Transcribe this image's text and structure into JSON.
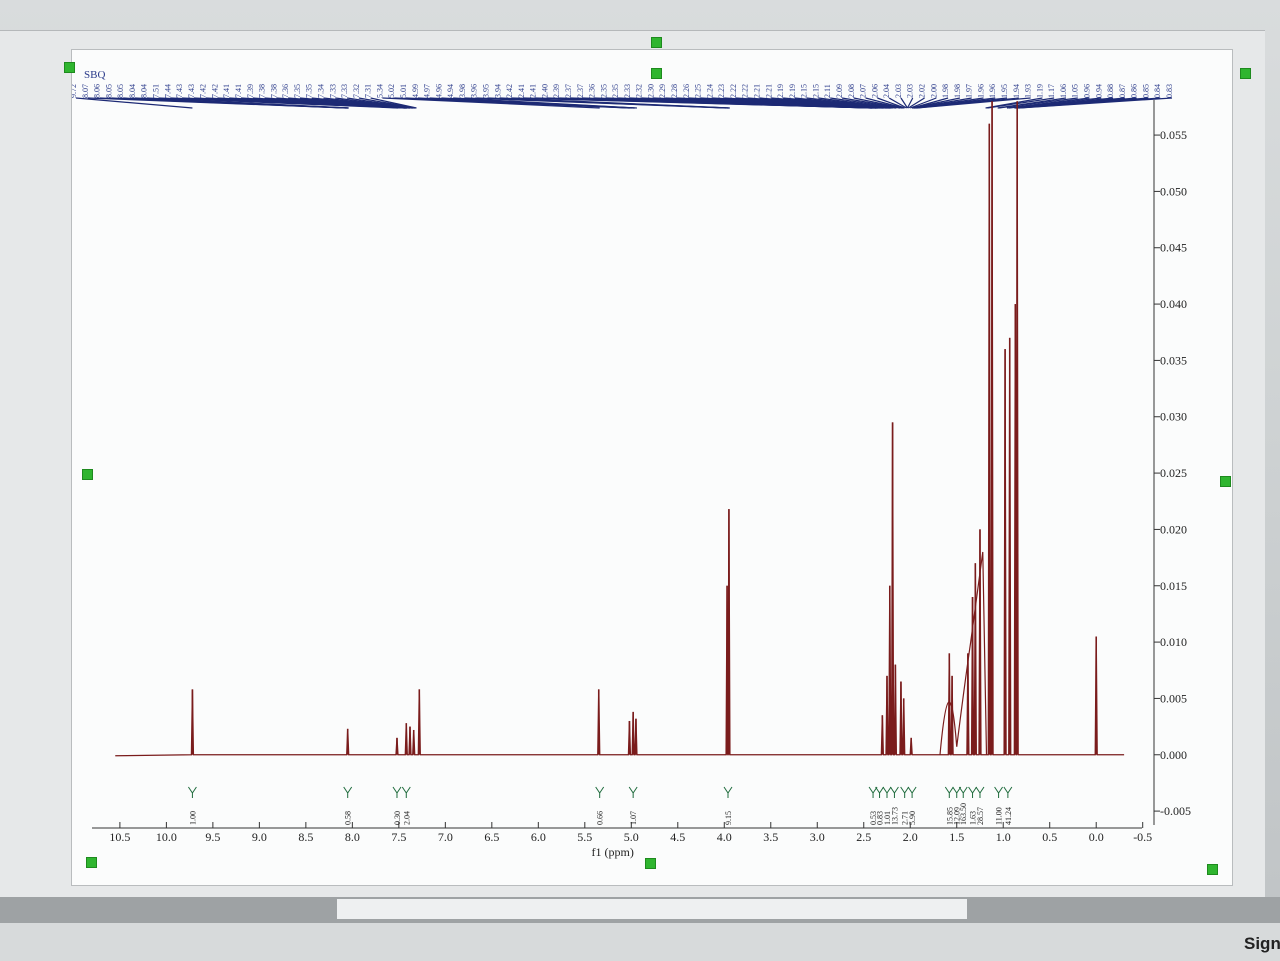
{
  "header": {
    "sample_label": "SBQ"
  },
  "chart_data": {
    "type": "line",
    "title": "",
    "xlabel": "f1 (ppm)",
    "ylabel": "",
    "xlim": [
      10.8,
      -0.6
    ],
    "ylim": [
      -0.0065,
      0.059
    ],
    "x_ticks": [
      "10.5",
      "10.0",
      "9.5",
      "9.0",
      "8.5",
      "8.0",
      "7.5",
      "7.0",
      "6.5",
      "6.0",
      "5.5",
      "5.0",
      "4.5",
      "4.0",
      "3.5",
      "3.0",
      "2.5",
      "2.0",
      "1.5",
      "1.0",
      "0.5",
      "0.0",
      "-0.5"
    ],
    "y_ticks": [
      "0.055",
      "0.050",
      "0.045",
      "0.040",
      "0.035",
      "0.030",
      "0.025",
      "0.020",
      "0.015",
      "0.010",
      "0.005",
      "0.000",
      "-0.005"
    ],
    "grid": false,
    "series": [
      {
        "peaks": [
          {
            "x": 9.72,
            "y": 0.0058
          },
          {
            "x": 8.05,
            "y": 0.0023
          },
          {
            "x": 7.52,
            "y": 0.0015
          },
          {
            "x": 7.42,
            "y": 0.0028
          },
          {
            "x": 7.38,
            "y": 0.0025
          },
          {
            "x": 7.34,
            "y": 0.0022
          },
          {
            "x": 7.28,
            "y": 0.0058
          },
          {
            "x": 5.35,
            "y": 0.0058
          },
          {
            "x": 5.02,
            "y": 0.003
          },
          {
            "x": 4.98,
            "y": 0.0038
          },
          {
            "x": 4.95,
            "y": 0.0032
          },
          {
            "x": 3.95,
            "y": 0.0218
          },
          {
            "x": 3.97,
            "y": 0.015
          },
          {
            "x": 2.3,
            "y": 0.0035
          },
          {
            "x": 2.25,
            "y": 0.007
          },
          {
            "x": 2.22,
            "y": 0.015
          },
          {
            "x": 2.19,
            "y": 0.0295
          },
          {
            "x": 2.16,
            "y": 0.008
          },
          {
            "x": 2.1,
            "y": 0.0065
          },
          {
            "x": 2.07,
            "y": 0.005
          },
          {
            "x": 1.99,
            "y": 0.0015
          },
          {
            "x": 1.58,
            "y": 0.009
          },
          {
            "x": 1.55,
            "y": 0.007
          },
          {
            "x": 1.38,
            "y": 0.009
          },
          {
            "x": 1.33,
            "y": 0.014
          },
          {
            "x": 1.3,
            "y": 0.017
          },
          {
            "x": 1.25,
            "y": 0.02
          },
          {
            "x": 1.15,
            "y": 0.056
          },
          {
            "x": 1.12,
            "y": 0.058
          },
          {
            "x": 0.98,
            "y": 0.036
          },
          {
            "x": 0.93,
            "y": 0.037
          },
          {
            "x": 0.87,
            "y": 0.04
          },
          {
            "x": 0.85,
            "y": 0.058
          },
          {
            "x": 0.0,
            "y": 0.0105
          }
        ]
      }
    ],
    "peak_labels": [
      "9.72",
      "8.07",
      "8.06",
      "8.05",
      "8.05",
      "8.04",
      "8.04",
      "7.51",
      "7.44",
      "7.43",
      "7.43",
      "7.42",
      "7.42",
      "7.41",
      "7.41",
      "7.39",
      "7.38",
      "7.38",
      "7.36",
      "7.35",
      "7.35",
      "7.34",
      "7.33",
      "7.33",
      "7.32",
      "7.31",
      "5.34",
      "5.02",
      "5.01",
      "4.99",
      "4.97",
      "4.96",
      "4.94",
      "3.98",
      "3.96",
      "3.95",
      "3.94",
      "2.42",
      "2.41",
      "2.41",
      "2.40",
      "2.39",
      "2.37",
      "2.37",
      "2.36",
      "2.35",
      "2.35",
      "2.33",
      "2.32",
      "2.30",
      "2.29",
      "2.28",
      "2.26",
      "2.25",
      "2.24",
      "2.23",
      "2.22",
      "2.22",
      "2.21",
      "2.21",
      "2.19",
      "2.19",
      "2.15",
      "2.15",
      "2.11",
      "2.09",
      "2.08",
      "2.07",
      "2.06",
      "2.04",
      "2.03",
      "2.03",
      "2.02",
      "2.00",
      "1.98",
      "1.98",
      "1.97",
      "1.96",
      "1.96",
      "1.95",
      "1.94",
      "1.93",
      "1.19",
      "1.17",
      "1.06",
      "1.05",
      "0.96",
      "0.94",
      "0.88",
      "0.87",
      "0.86",
      "0.85",
      "0.84",
      "0.83"
    ],
    "integrals": [
      {
        "x": 9.72,
        "value": "1.00"
      },
      {
        "x": 8.05,
        "value": "0.58"
      },
      {
        "x": 7.52,
        "value": "0.30"
      },
      {
        "x": 7.42,
        "value": "2.04"
      },
      {
        "x": 5.34,
        "value": "0.66"
      },
      {
        "x": 4.98,
        "value": "1.07"
      },
      {
        "x": 3.96,
        "value": "9.15"
      },
      {
        "x": 2.4,
        "value": "0.53"
      },
      {
        "x": 2.33,
        "value": "0.83"
      },
      {
        "x": 2.25,
        "value": "1.01"
      },
      {
        "x": 2.17,
        "value": "13.73"
      },
      {
        "x": 2.06,
        "value": "2.71"
      },
      {
        "x": 1.98,
        "value": "5.90"
      },
      {
        "x": 1.58,
        "value": "15.85"
      },
      {
        "x": 1.5,
        "value": "12.09"
      },
      {
        "x": 1.43,
        "value": "163.50"
      },
      {
        "x": 1.33,
        "value": "1.63"
      },
      {
        "x": 1.25,
        "value": "28.57"
      },
      {
        "x": 1.05,
        "value": "11.00"
      },
      {
        "x": 0.95,
        "value": "41.24"
      }
    ]
  },
  "taskbar": {
    "sign_label": "Sign"
  },
  "colors": {
    "spectrum": "#7a1c1c",
    "peak_label": "#2a3a8a",
    "handle": "#2fb52f"
  }
}
